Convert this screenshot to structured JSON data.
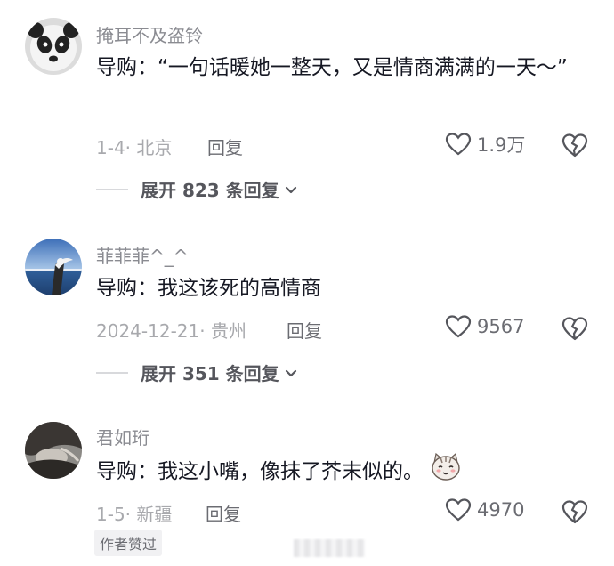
{
  "comments": [
    {
      "username": "掩耳不及盗铃",
      "text": "导购：“一句话暖她一整天，又是情商满满的一天～”",
      "meta": "1-4· 北京",
      "reply_label": "回复",
      "likes": "1.9万",
      "expand_label": "展开 823 条回复",
      "avatar_icon": "panda-avatar"
    },
    {
      "username": "菲菲菲^_^",
      "text": "导购：我这该死的高情商",
      "meta": "2024-12-21· 贵州",
      "reply_label": "回复",
      "likes": "9567",
      "expand_label": "展开 351 条回复",
      "avatar_icon": "bird-sea-avatar"
    },
    {
      "username": "君如珩",
      "text": "导购：我这小嘴，像抹了芥末似的。",
      "meta": "1-5· 新疆",
      "reply_label": "回复",
      "likes": "4970",
      "badge": "作者赞过",
      "avatar_icon": "dark-photo-avatar",
      "emoji_icon": "cat-face-emoji"
    }
  ],
  "colors": {
    "text": "#161823",
    "secondary": "#8a8b91",
    "meta": "#a8a9ad"
  }
}
